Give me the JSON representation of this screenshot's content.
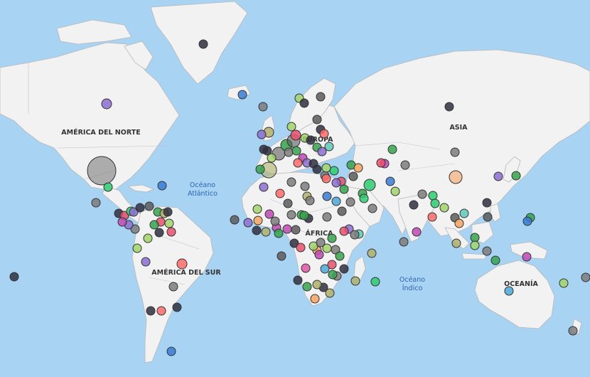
{
  "map": {
    "colors": {
      "ocean": "#a8d3f3",
      "land": "#f2f2f2",
      "border": "#b8b8b8"
    },
    "continent_labels": [
      {
        "id": "north-america",
        "text": "AMÉRICA DEL NORTE"
      },
      {
        "id": "south-america",
        "text": "AMÉRICA DEL SUR"
      },
      {
        "id": "europe",
        "text": "EUROPA"
      },
      {
        "id": "africa",
        "text": "ÁFRICA"
      },
      {
        "id": "asia",
        "text": "ASIA"
      },
      {
        "id": "oceania",
        "text": "OCEANÍA"
      }
    ],
    "ocean_labels": [
      {
        "id": "atlantic",
        "lines": [
          "Océano",
          "Atlántico"
        ]
      },
      {
        "id": "indian",
        "lines": [
          "Océano",
          "Índico"
        ]
      }
    ],
    "marker_colors": [
      "#7d7d7d",
      "#5c5c5c",
      "#a2d46a",
      "#8c6fd1",
      "#35a34d",
      "#e8506e",
      "#3a7bd5",
      "#f4a460",
      "#c04ab5",
      "#2ecc71",
      "#ff6b6b",
      "#4aa8d8",
      "#b0b06a",
      "#2f2f3f",
      "#e056a8",
      "#5fc9b8"
    ]
  }
}
